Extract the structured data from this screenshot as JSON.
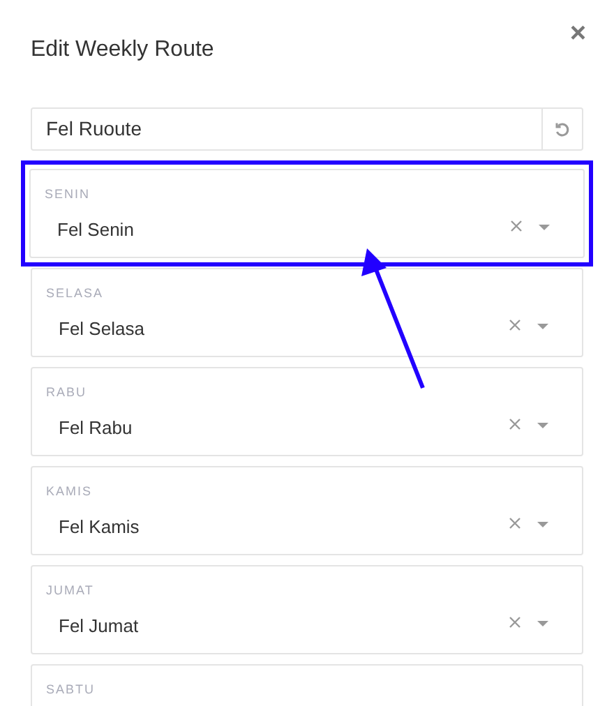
{
  "dialog": {
    "title": "Edit Weekly Route",
    "close": "×"
  },
  "route_name": {
    "value": "Fel Ruoute"
  },
  "days": [
    {
      "label": "SENIN",
      "value": "Fel Senin",
      "highlighted": true
    },
    {
      "label": "SELASA",
      "value": "Fel Selasa",
      "highlighted": false
    },
    {
      "label": "RABU",
      "value": "Fel Rabu",
      "highlighted": false
    },
    {
      "label": "KAMIS",
      "value": "Fel Kamis",
      "highlighted": false
    },
    {
      "label": "JUMAT",
      "value": "Fel Jumat",
      "highlighted": false
    },
    {
      "label": "SABTU",
      "highlighted": false
    }
  ]
}
